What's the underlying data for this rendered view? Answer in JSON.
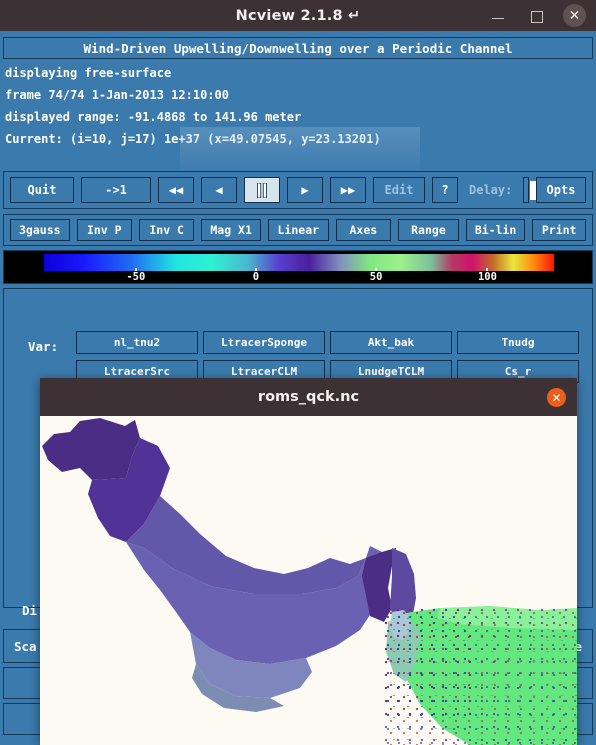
{
  "window": {
    "title": "Ncview 2.1.8 ↵",
    "controls": {
      "minimize": "−",
      "maximize": "□",
      "close": "✕"
    }
  },
  "headline": {
    "text": "Wind-Driven Upwelling/Downwelling over a Periodic Channel"
  },
  "info": {
    "line1": "displaying free-surface",
    "line2": "frame 74/74 1-Jan-2013 12:10:00",
    "line3": "displayed range: -91.4868 to 141.96 meter",
    "line4": "Current: (i=10, j=17) 1e+37 (x=49.07545, y=23.13201)"
  },
  "controls": {
    "quit": "Quit",
    "rewind_to_first": "->1",
    "fast_backward": "◀◀",
    "step_backward": "◀",
    "pause": "❚❚",
    "step_forward": "▶",
    "fast_forward": "▶▶",
    "edit": "Edit",
    "help": "?",
    "delay_label": "Delay:",
    "delay_value": "",
    "opts": "Opts"
  },
  "options": [
    {
      "name": "colormap",
      "label": "3gauss"
    },
    {
      "name": "invert-physical",
      "label": "Inv P"
    },
    {
      "name": "invert-colormap",
      "label": "Inv C"
    },
    {
      "name": "magnification",
      "label": "Mag X1"
    },
    {
      "name": "scale-transform",
      "label": "Linear"
    },
    {
      "name": "axes",
      "label": "Axes"
    },
    {
      "name": "range",
      "label": "Range"
    },
    {
      "name": "interpolation",
      "label": "Bi-lin"
    },
    {
      "name": "print",
      "label": "Print"
    }
  ],
  "colorbar": {
    "ticks": [
      {
        "label": "-50",
        "pos_pct": 22.5
      },
      {
        "label": "0",
        "pos_pct": 43.0
      },
      {
        "label": "50",
        "pos_pct": 63.5
      },
      {
        "label": "100",
        "pos_pct": 82.5
      }
    ],
    "gradient_stops": [
      {
        "pct": 0,
        "color": "#0b00d8"
      },
      {
        "pct": 8,
        "color": "#1a1aff"
      },
      {
        "pct": 17,
        "color": "#1f6cf2"
      },
      {
        "pct": 26,
        "color": "#21e6e0"
      },
      {
        "pct": 33,
        "color": "#2ff0d2"
      },
      {
        "pct": 40,
        "color": "#4bb6cf"
      },
      {
        "pct": 46,
        "color": "#5a3fd0"
      },
      {
        "pct": 52,
        "color": "#4a1f9c"
      },
      {
        "pct": 58,
        "color": "#7f8fc0"
      },
      {
        "pct": 64,
        "color": "#7fe97f"
      },
      {
        "pct": 70,
        "color": "#9df08a"
      },
      {
        "pct": 76,
        "color": "#7abf9b"
      },
      {
        "pct": 80,
        "color": "#b53864"
      },
      {
        "pct": 84,
        "color": "#d0126d"
      },
      {
        "pct": 88,
        "color": "#c46a2a"
      },
      {
        "pct": 92,
        "color": "#e8e83c"
      },
      {
        "pct": 96,
        "color": "#ff8a10"
      },
      {
        "pct": 100,
        "color": "#ff1408"
      }
    ]
  },
  "variables": {
    "label": "Var:",
    "buttons": [
      "nl_tnu2",
      "LtracerSponge",
      "Akt_bak",
      "Tnudg",
      "LtracerSrc",
      "LtracerCLM",
      "LnudgeTCLM",
      "Cs_r"
    ]
  },
  "bottom": {
    "dimension_label": "Di",
    "scan_label": "Sca",
    "right_label": "ce"
  },
  "dialog": {
    "title": "roms_qck.nc",
    "close": "✕",
    "plot": {
      "background": "#fdfaf4",
      "field_colors": {
        "deep_purple": "#4b2d85",
        "mid_purple": "#5a3f9e",
        "light_purple": "#6f63b0",
        "pale_purple": "#8086bd",
        "slate_blue": "#7d8cb2",
        "green_plume": "#63e87f",
        "green_light": "#8bf09a"
      }
    }
  }
}
